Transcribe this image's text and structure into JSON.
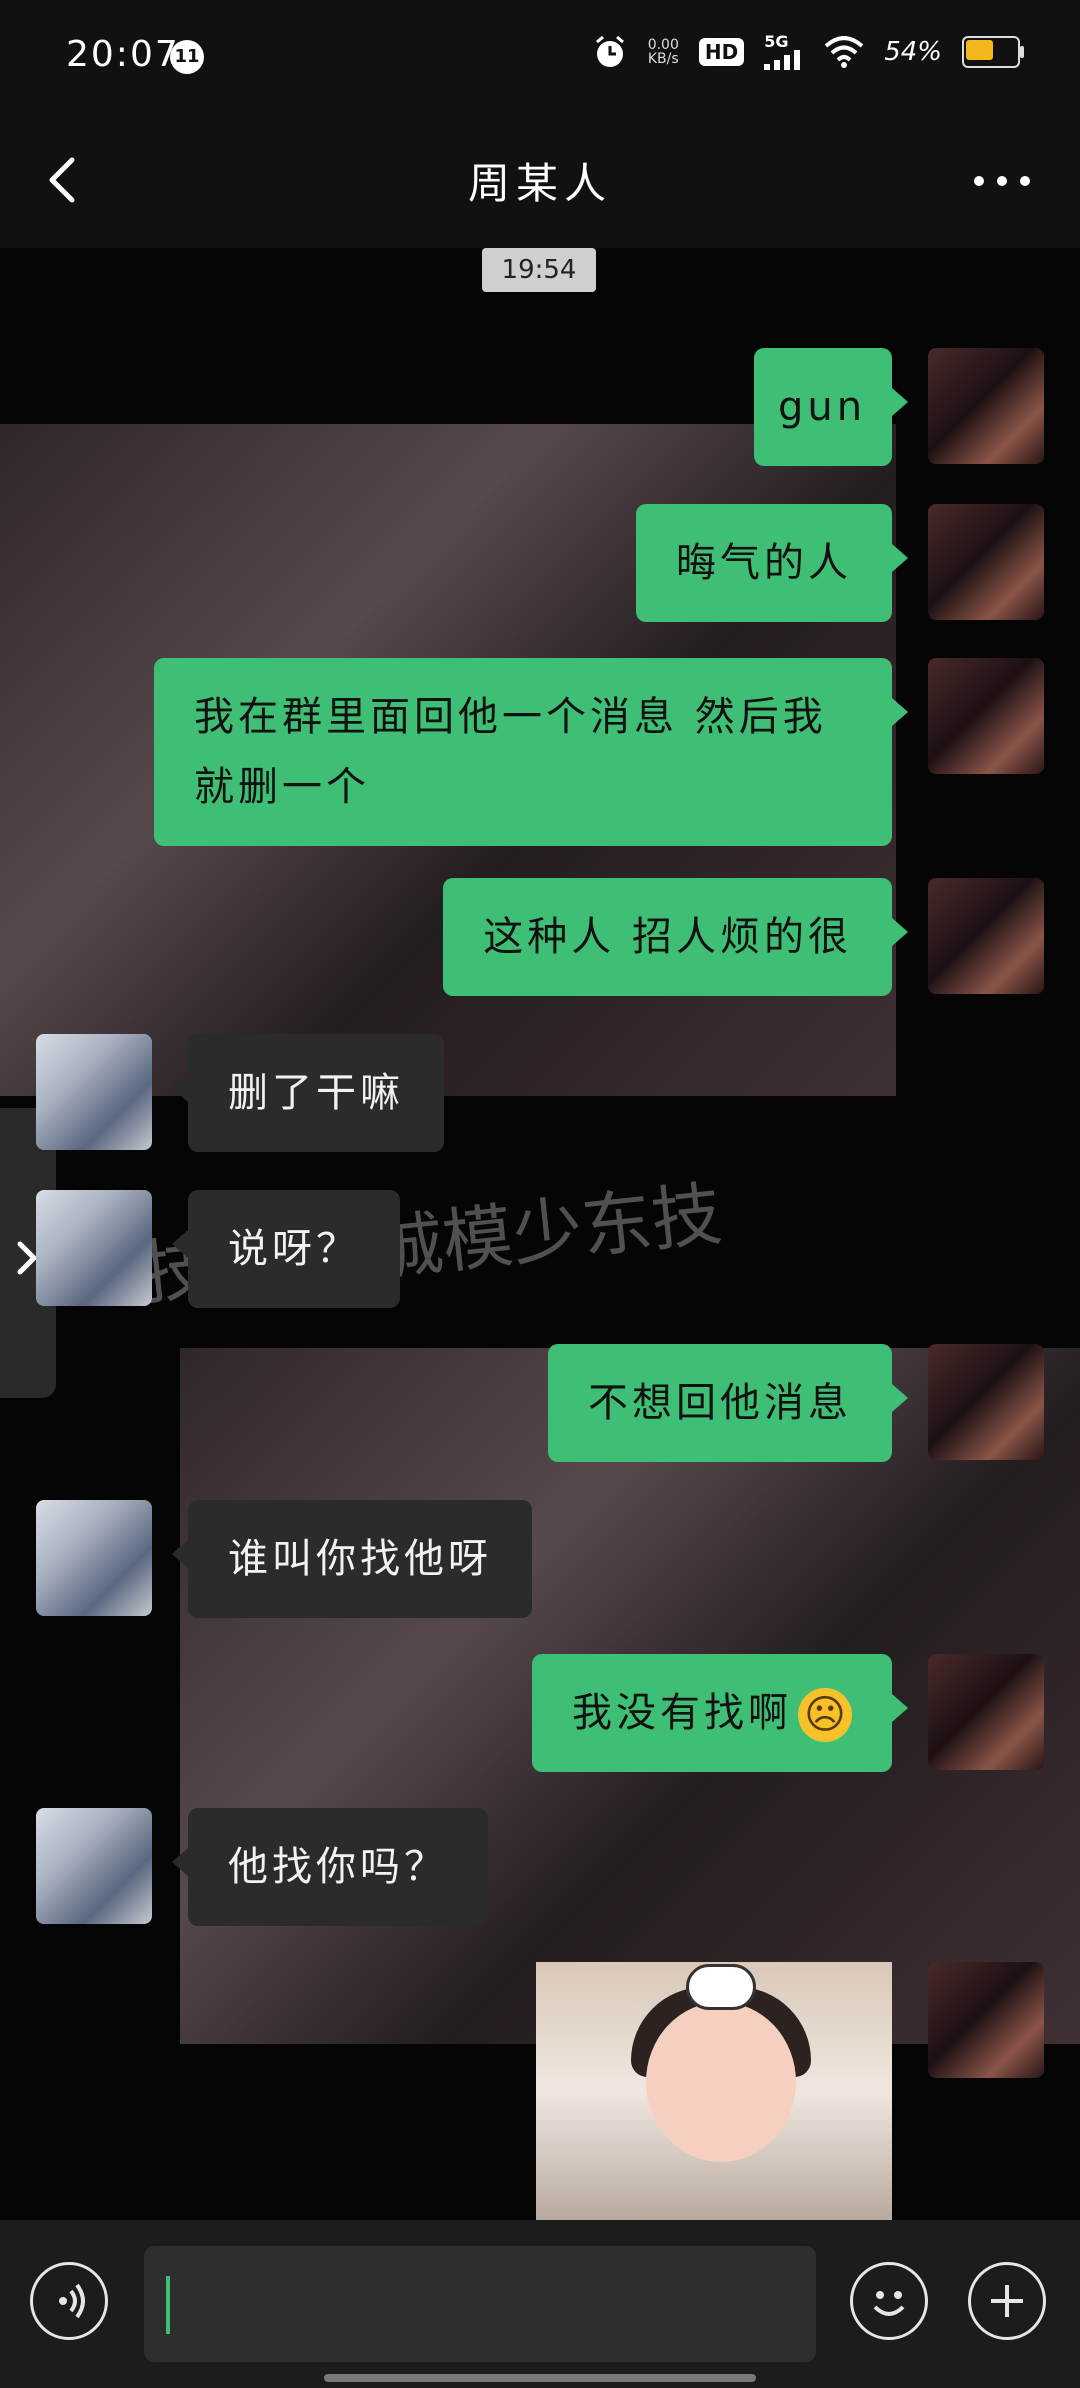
{
  "status_bar": {
    "time": "20:07",
    "badge_text": "11",
    "net_speed_value": "0.00",
    "net_speed_unit": "KB/s",
    "hd_label": "HD",
    "network_type": "5G",
    "battery_percent": "54%",
    "battery_level": 0.54,
    "battery_color": "#f4b81c",
    "icons": [
      "alarm-icon",
      "signal-icon",
      "wifi-icon",
      "battery-icon"
    ]
  },
  "header": {
    "title": "周某人",
    "back_icon": "chevron-left-icon",
    "more_icon": "more-dots-icon"
  },
  "chat": {
    "timestamp": "19:54",
    "bubble_colors": {
      "sent": "#3ebf75",
      "received": "#2b2b2b"
    },
    "messages": [
      {
        "side": "me",
        "text": "gun"
      },
      {
        "side": "me",
        "text": "晦气的人"
      },
      {
        "side": "me",
        "text": "我在群里面回他一个消息 然后我就删一个"
      },
      {
        "side": "me",
        "text": "这种人 招人烦的很"
      },
      {
        "side": "other",
        "text": "删了干嘛"
      },
      {
        "side": "other",
        "text": "说呀？"
      },
      {
        "side": "me",
        "text": "不想回他消息"
      },
      {
        "side": "other",
        "text": "谁叫你找他呀"
      },
      {
        "side": "me",
        "text": "我没有找啊",
        "emoji": "☹"
      },
      {
        "side": "other",
        "text": "他找你吗？"
      },
      {
        "side": "me",
        "type": "image-sticker"
      }
    ],
    "background_text": "技巧 真诚模少东技"
  },
  "input_bar": {
    "voice_icon": "voice-icon",
    "emoji_icon": "emoji-icon",
    "plus_icon": "plus-icon",
    "input_value": ""
  }
}
